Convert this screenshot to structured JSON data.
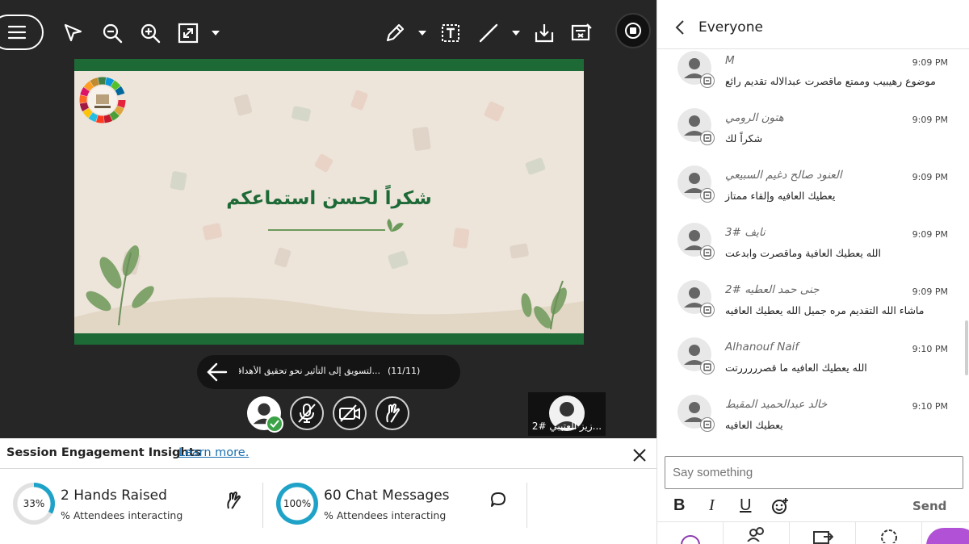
{
  "colors": {
    "slide_green": "#1e6a37",
    "ring_accent": "#1fa2c8",
    "link": "#1a6fb0",
    "check_green": "#3ca248",
    "fab_purple": "#b152d6"
  },
  "toolbar": {
    "icons": [
      "menu-icon",
      "pointer-icon",
      "zoom-out-icon",
      "zoom-in-icon",
      "fit-screen-icon",
      "dropdown-caret-icon",
      "pen-icon",
      "text-tool-icon",
      "line-tool-icon",
      "download-icon",
      "clear-slide-icon",
      "record-icon"
    ]
  },
  "slide": {
    "title": "شكراً لحسن استماعكم"
  },
  "slide_nav": {
    "file_name": "...لتسويق إلى التأثير نحو تحقيق الأهداف",
    "counter": "(11/11)"
  },
  "participant_tile": {
    "name": "...زيز العتيبي #2"
  },
  "insights": {
    "title": "Session Engagement Insights",
    "learn_more": "Learn more.",
    "metrics": [
      {
        "percent": "33%",
        "percent_value": 33,
        "title": "2 Hands Raised",
        "subtitle": "% Attendees interacting",
        "icon": "hand-raise-icon"
      },
      {
        "percent": "100%",
        "percent_value": 100,
        "title": "60 Chat Messages",
        "subtitle": "% Attendees interacting",
        "icon": "chat-bubble-icon"
      }
    ]
  },
  "chat": {
    "title": "Everyone",
    "messages": [
      {
        "author": "M",
        "time": "9:09 PM",
        "text": "موضوع رهيبيب وممتع ماقصرت عبدالاله تقديم رائع"
      },
      {
        "author": "هتون الرومي",
        "time": "9:09 PM",
        "text": "شكراً لك"
      },
      {
        "author": "العنود صالح دغيم السبيعي",
        "time": "9:09 PM",
        "text": "يعطيك العافيه وإلقاء ممتاز"
      },
      {
        "author": "نايف #3",
        "time": "9:09 PM",
        "text": "الله يعطيك العافية وماقصرت وابدعت"
      },
      {
        "author": "جنى حمد العطيه #2",
        "time": "9:09 PM",
        "text": "ماشاء الله التقديم مره جميل الله يعطيك العافيه"
      },
      {
        "author": "Alhanouf Naif",
        "time": "9:10 PM",
        "text": "الله يعطيك العافيه ما قصرررررتت"
      },
      {
        "author": "خالد عبدالحميد المقيط",
        "time": "9:10 PM",
        "text": "يعطيك العافيه"
      }
    ],
    "input_placeholder": "Say something",
    "format": {
      "bold": "B",
      "italic": "I",
      "underline": "U"
    },
    "send_label": "Send"
  }
}
